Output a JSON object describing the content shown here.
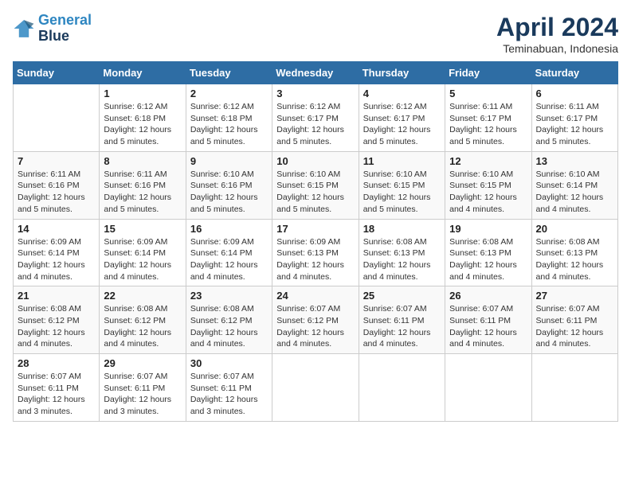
{
  "logo": {
    "line1": "General",
    "line2": "Blue"
  },
  "title": "April 2024",
  "subtitle": "Teminabuan, Indonesia",
  "headers": [
    "Sunday",
    "Monday",
    "Tuesday",
    "Wednesday",
    "Thursday",
    "Friday",
    "Saturday"
  ],
  "weeks": [
    [
      {
        "num": "",
        "info": ""
      },
      {
        "num": "1",
        "info": "Sunrise: 6:12 AM\nSunset: 6:18 PM\nDaylight: 12 hours\nand 5 minutes."
      },
      {
        "num": "2",
        "info": "Sunrise: 6:12 AM\nSunset: 6:18 PM\nDaylight: 12 hours\nand 5 minutes."
      },
      {
        "num": "3",
        "info": "Sunrise: 6:12 AM\nSunset: 6:17 PM\nDaylight: 12 hours\nand 5 minutes."
      },
      {
        "num": "4",
        "info": "Sunrise: 6:12 AM\nSunset: 6:17 PM\nDaylight: 12 hours\nand 5 minutes."
      },
      {
        "num": "5",
        "info": "Sunrise: 6:11 AM\nSunset: 6:17 PM\nDaylight: 12 hours\nand 5 minutes."
      },
      {
        "num": "6",
        "info": "Sunrise: 6:11 AM\nSunset: 6:17 PM\nDaylight: 12 hours\nand 5 minutes."
      }
    ],
    [
      {
        "num": "7",
        "info": "Sunrise: 6:11 AM\nSunset: 6:16 PM\nDaylight: 12 hours\nand 5 minutes."
      },
      {
        "num": "8",
        "info": "Sunrise: 6:11 AM\nSunset: 6:16 PM\nDaylight: 12 hours\nand 5 minutes."
      },
      {
        "num": "9",
        "info": "Sunrise: 6:10 AM\nSunset: 6:16 PM\nDaylight: 12 hours\nand 5 minutes."
      },
      {
        "num": "10",
        "info": "Sunrise: 6:10 AM\nSunset: 6:15 PM\nDaylight: 12 hours\nand 5 minutes."
      },
      {
        "num": "11",
        "info": "Sunrise: 6:10 AM\nSunset: 6:15 PM\nDaylight: 12 hours\nand 5 minutes."
      },
      {
        "num": "12",
        "info": "Sunrise: 6:10 AM\nSunset: 6:15 PM\nDaylight: 12 hours\nand 4 minutes."
      },
      {
        "num": "13",
        "info": "Sunrise: 6:10 AM\nSunset: 6:14 PM\nDaylight: 12 hours\nand 4 minutes."
      }
    ],
    [
      {
        "num": "14",
        "info": "Sunrise: 6:09 AM\nSunset: 6:14 PM\nDaylight: 12 hours\nand 4 minutes."
      },
      {
        "num": "15",
        "info": "Sunrise: 6:09 AM\nSunset: 6:14 PM\nDaylight: 12 hours\nand 4 minutes."
      },
      {
        "num": "16",
        "info": "Sunrise: 6:09 AM\nSunset: 6:14 PM\nDaylight: 12 hours\nand 4 minutes."
      },
      {
        "num": "17",
        "info": "Sunrise: 6:09 AM\nSunset: 6:13 PM\nDaylight: 12 hours\nand 4 minutes."
      },
      {
        "num": "18",
        "info": "Sunrise: 6:08 AM\nSunset: 6:13 PM\nDaylight: 12 hours\nand 4 minutes."
      },
      {
        "num": "19",
        "info": "Sunrise: 6:08 AM\nSunset: 6:13 PM\nDaylight: 12 hours\nand 4 minutes."
      },
      {
        "num": "20",
        "info": "Sunrise: 6:08 AM\nSunset: 6:13 PM\nDaylight: 12 hours\nand 4 minutes."
      }
    ],
    [
      {
        "num": "21",
        "info": "Sunrise: 6:08 AM\nSunset: 6:12 PM\nDaylight: 12 hours\nand 4 minutes."
      },
      {
        "num": "22",
        "info": "Sunrise: 6:08 AM\nSunset: 6:12 PM\nDaylight: 12 hours\nand 4 minutes."
      },
      {
        "num": "23",
        "info": "Sunrise: 6:08 AM\nSunset: 6:12 PM\nDaylight: 12 hours\nand 4 minutes."
      },
      {
        "num": "24",
        "info": "Sunrise: 6:07 AM\nSunset: 6:12 PM\nDaylight: 12 hours\nand 4 minutes."
      },
      {
        "num": "25",
        "info": "Sunrise: 6:07 AM\nSunset: 6:11 PM\nDaylight: 12 hours\nand 4 minutes."
      },
      {
        "num": "26",
        "info": "Sunrise: 6:07 AM\nSunset: 6:11 PM\nDaylight: 12 hours\nand 4 minutes."
      },
      {
        "num": "27",
        "info": "Sunrise: 6:07 AM\nSunset: 6:11 PM\nDaylight: 12 hours\nand 4 minutes."
      }
    ],
    [
      {
        "num": "28",
        "info": "Sunrise: 6:07 AM\nSunset: 6:11 PM\nDaylight: 12 hours\nand 3 minutes."
      },
      {
        "num": "29",
        "info": "Sunrise: 6:07 AM\nSunset: 6:11 PM\nDaylight: 12 hours\nand 3 minutes."
      },
      {
        "num": "30",
        "info": "Sunrise: 6:07 AM\nSunset: 6:11 PM\nDaylight: 12 hours\nand 3 minutes."
      },
      {
        "num": "",
        "info": ""
      },
      {
        "num": "",
        "info": ""
      },
      {
        "num": "",
        "info": ""
      },
      {
        "num": "",
        "info": ""
      }
    ]
  ]
}
